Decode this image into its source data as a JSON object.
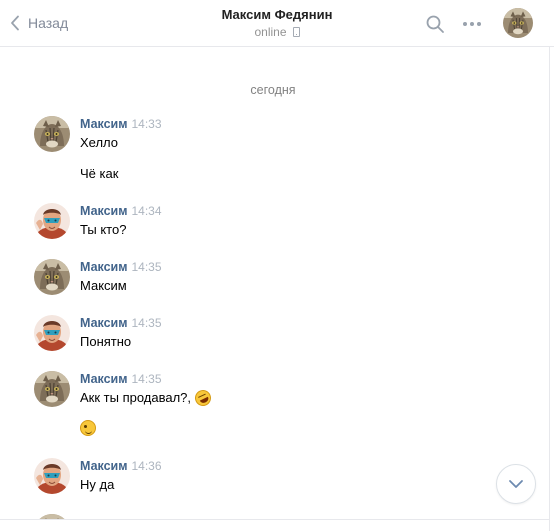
{
  "header": {
    "back_label": "Назад",
    "peer_name": "Максим Федянин",
    "peer_status": "online"
  },
  "feed": {
    "date_separator": "сегодня",
    "messages": [
      {
        "author": "Максим",
        "time": "14:33",
        "avatar": "cat-avatar",
        "lines": [
          "Хелло",
          "Чё как"
        ]
      },
      {
        "author": "Максим",
        "time": "14:34",
        "avatar": "masked-man-avatar",
        "lines": [
          "Ты кто?"
        ]
      },
      {
        "author": "Максим",
        "time": "14:35",
        "avatar": "cat-avatar",
        "lines": [
          "Максим"
        ]
      },
      {
        "author": "Максим",
        "time": "14:35",
        "avatar": "masked-man-avatar",
        "lines": [
          "Понятно"
        ]
      },
      {
        "author": "Максим",
        "time": "14:35",
        "avatar": "cat-avatar",
        "lines": [
          "Акк ты продавал?,"
        ],
        "emoji_after_first_line": "rolling-on-floor-laughing",
        "emoji_line": "winking-face"
      },
      {
        "author": "Максим",
        "time": "14:36",
        "avatar": "masked-man-avatar",
        "lines": [
          "Ну да"
        ]
      }
    ]
  },
  "icons": {
    "back": "chevron-left-icon",
    "search": "search-icon",
    "more": "more-dots-icon",
    "device": "mobile-phone-icon",
    "scroll": "chevron-down-icon"
  },
  "colors": {
    "author": "#42648b",
    "time": "#adb5bf",
    "muted": "#828a99",
    "divider": "#e7e8ec"
  }
}
